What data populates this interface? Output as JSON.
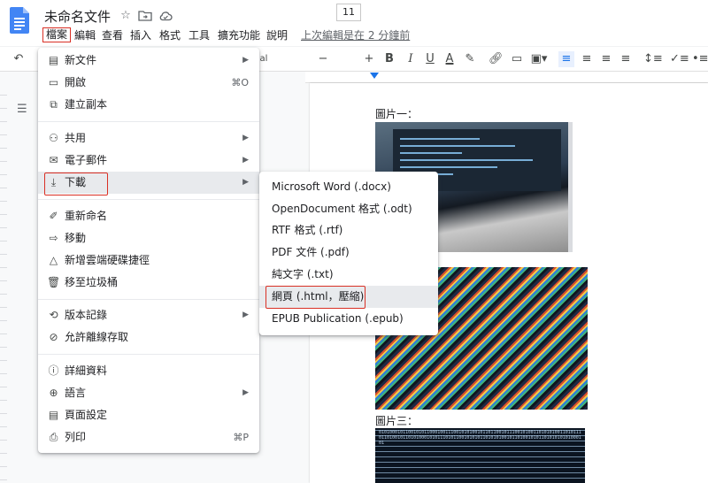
{
  "doc": {
    "title": "未命名文件",
    "star_icon": "star-icon",
    "move_icon": "folder-move-icon",
    "cloud_icon": "cloud-status-icon"
  },
  "menubar": {
    "file": "檔案",
    "edit": "編輯",
    "view": "查看",
    "insert": "插入",
    "format": "格式",
    "tools": "工具",
    "extensions": "擴充功能",
    "help": "說明",
    "last_edit": "上次編輯是在 2 分鐘前"
  },
  "toolbar": {
    "font_size": "11",
    "style_fragment": "al",
    "minus": "−",
    "plus": "+",
    "bold": "B",
    "italic": "I",
    "underline": "U",
    "text_color": "A"
  },
  "file_menu": {
    "items": [
      {
        "label": "新文件",
        "shortcut": "",
        "submenu": true,
        "icon": "document-icon"
      },
      {
        "label": "開啟",
        "shortcut": "⌘O",
        "submenu": false,
        "icon": "folder-icon"
      },
      {
        "label": "建立副本",
        "shortcut": "",
        "submenu": false,
        "icon": "copy-icon"
      },
      {
        "label": "共用",
        "shortcut": "",
        "submenu": true,
        "icon": "share-person-icon"
      },
      {
        "label": "電子郵件",
        "shortcut": "",
        "submenu": true,
        "icon": "mail-icon"
      },
      {
        "label": "下載",
        "shortcut": "",
        "submenu": true,
        "icon": "download-icon"
      },
      {
        "label": "重新命名",
        "shortcut": "",
        "submenu": false,
        "icon": "rename-icon"
      },
      {
        "label": "移動",
        "shortcut": "",
        "submenu": false,
        "icon": "move-icon"
      },
      {
        "label": "新增雲端硬碟捷徑",
        "shortcut": "",
        "submenu": false,
        "icon": "drive-shortcut-icon"
      },
      {
        "label": "移至垃圾桶",
        "shortcut": "",
        "submenu": false,
        "icon": "trash-icon"
      },
      {
        "label": "版本記錄",
        "shortcut": "",
        "submenu": true,
        "icon": "history-icon"
      },
      {
        "label": "允許離線存取",
        "shortcut": "",
        "submenu": false,
        "icon": "offline-icon"
      },
      {
        "label": "詳細資料",
        "shortcut": "",
        "submenu": false,
        "icon": "info-icon"
      },
      {
        "label": "語言",
        "shortcut": "",
        "submenu": true,
        "icon": "globe-icon"
      },
      {
        "label": "頁面設定",
        "shortcut": "",
        "submenu": false,
        "icon": "page-setup-icon"
      },
      {
        "label": "列印",
        "shortcut": "⌘P",
        "submenu": false,
        "icon": "print-icon"
      }
    ]
  },
  "download_menu": {
    "items": [
      "Microsoft Word (.docx)",
      "OpenDocument 格式 (.odt)",
      "RTF 格式 (.rtf)",
      "PDF 文件 (.pdf)",
      "純文字 (.txt)",
      "網頁 (.html，壓縮)",
      "EPUB Publication (.epub)"
    ]
  },
  "page": {
    "caption_1": "圖片一：",
    "caption_3": "圖片三：",
    "binary_text": "0101000101100101011000100111001010100101101100101110010100110101010011010111011010010110101000101011101011001010101101010100101101001010110101010101000101"
  },
  "colors": {
    "highlight_box": "#d93025",
    "docs_blue": "#4285f4",
    "selected_item_bg": "#e8eaed"
  }
}
